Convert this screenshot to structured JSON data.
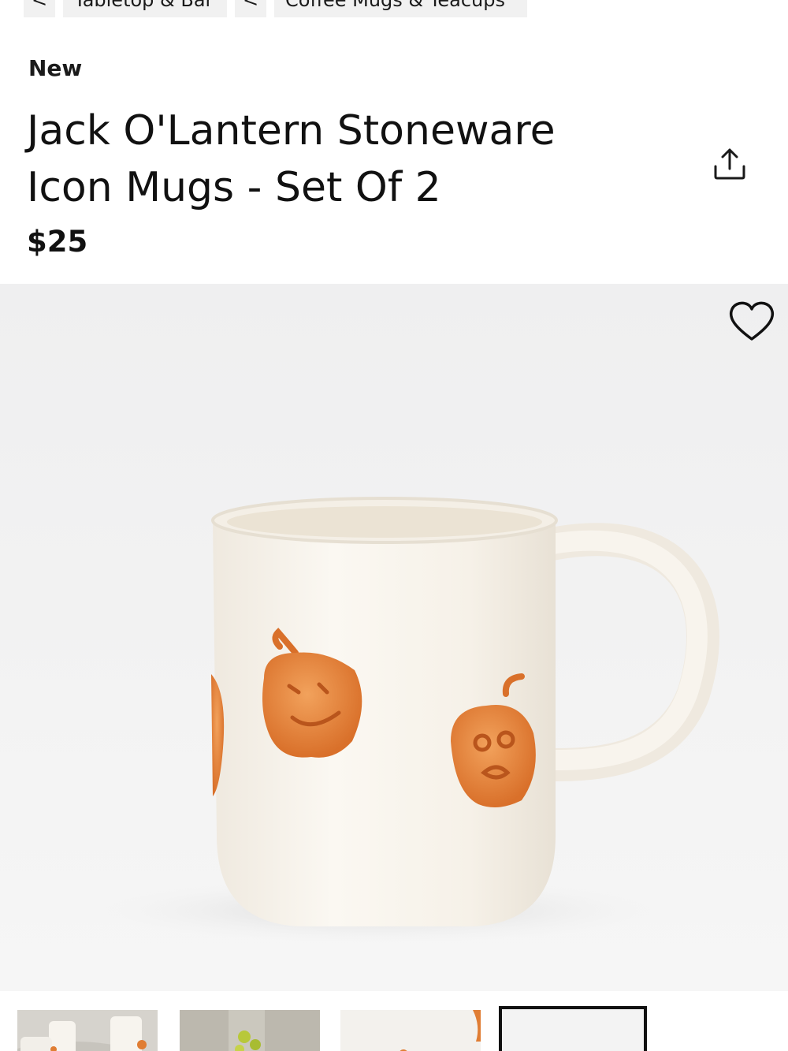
{
  "breadcrumb": {
    "back_glyph": "<",
    "items": [
      {
        "label": "Tabletop & Bar"
      },
      {
        "label": "Coffee Mugs & Teacups"
      }
    ]
  },
  "product": {
    "badge": "New",
    "title": "Jack O'Lantern Stoneware Icon Mugs - Set Of 2",
    "price": "$25"
  },
  "icons": {
    "share": "share-icon",
    "favorite": "heart-icon"
  },
  "gallery": {
    "thumbnail_count": 4,
    "selected_thumbnail": 4
  },
  "colors": {
    "text": "#111111",
    "chip_bg": "#f1f1f1",
    "pumpkin": "#e9823a"
  }
}
